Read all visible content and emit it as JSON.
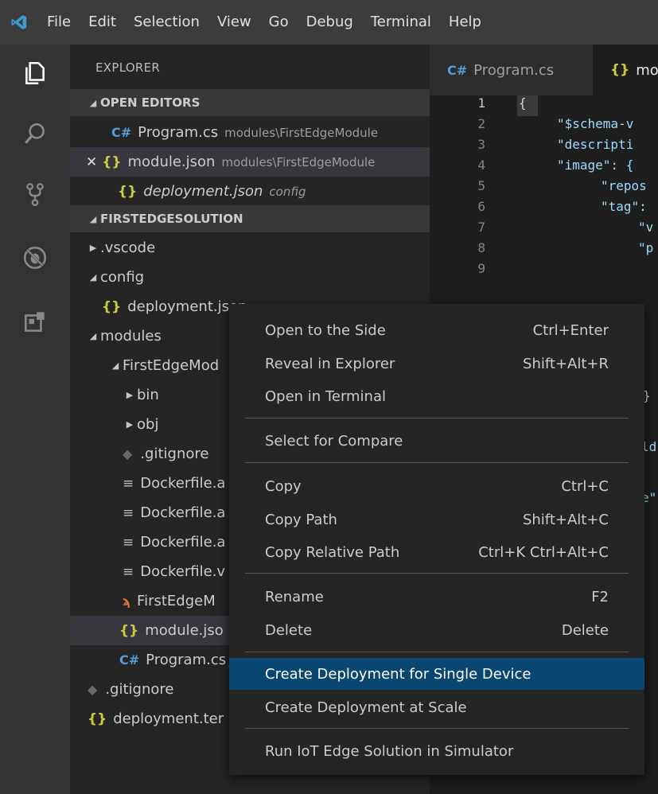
{
  "menubar": {
    "items": [
      "File",
      "Edit",
      "Selection",
      "View",
      "Go",
      "Debug",
      "Terminal",
      "Help"
    ]
  },
  "activitybar": {
    "icons": [
      "explorer-icon",
      "search-icon",
      "source-control-icon",
      "debug-icon",
      "extensions-icon"
    ]
  },
  "sidebar": {
    "title": "EXPLORER",
    "open_editors_header": "OPEN EDITORS",
    "open_editors": [
      {
        "name": "Program.cs",
        "desc": "modules\\FirstEdgeModule"
      },
      {
        "name": "module.json",
        "desc": "modules\\FirstEdgeModule"
      },
      {
        "name": "deployment.json",
        "desc": "config"
      }
    ],
    "workspace_header": "FIRSTEDGESOLUTION",
    "tree": [
      ".vscode",
      "config",
      "deployment.json",
      "modules",
      "FirstEdgeMod",
      "bin",
      "obj",
      ".gitignore",
      "Dockerfile.a",
      "Dockerfile.a",
      "Dockerfile.a",
      "Dockerfile.v",
      "FirstEdgeM",
      "module.jso",
      "Program.cs",
      ".gitignore",
      "deployment.ter"
    ]
  },
  "tabs": {
    "tab1": "Program.cs",
    "tab2": "mo"
  },
  "editor": {
    "line_numbers": [
      "1",
      "2",
      "3",
      "4",
      "5",
      "6",
      "7",
      "8",
      "9"
    ],
    "lines": [
      "{",
      "\"$schema-v",
      "\"descripti",
      "\"image\": {",
      "\"repos",
      "\"tag\":",
      "\"v",
      "\"p",
      ""
    ],
    "fragments": [
      "}",
      "ld",
      "e\""
    ]
  },
  "context_menu": {
    "items": [
      {
        "label": "Open to the Side",
        "shortcut": "Ctrl+Enter"
      },
      {
        "label": "Reveal in Explorer",
        "shortcut": "Shift+Alt+R"
      },
      {
        "label": "Open in Terminal",
        "shortcut": ""
      },
      {
        "label": "Select for Compare",
        "shortcut": ""
      },
      {
        "label": "Copy",
        "shortcut": "Ctrl+C"
      },
      {
        "label": "Copy Path",
        "shortcut": "Shift+Alt+C"
      },
      {
        "label": "Copy Relative Path",
        "shortcut": "Ctrl+K Ctrl+Alt+C"
      },
      {
        "label": "Rename",
        "shortcut": "F2"
      },
      {
        "label": "Delete",
        "shortcut": "Delete"
      },
      {
        "label": "Create Deployment for Single Device",
        "shortcut": ""
      },
      {
        "label": "Create Deployment at Scale",
        "shortcut": ""
      },
      {
        "label": "Run IoT Edge Solution in Simulator",
        "shortcut": ""
      }
    ],
    "highlighted": "Create Deployment for Single Device"
  },
  "colors": {
    "accent": "#094771",
    "menubar": "#3c3c3c",
    "sidebar": "#252526",
    "editor": "#1e1e1e",
    "json_icon": "#cbcb41",
    "cs_icon": "#569cd6"
  }
}
